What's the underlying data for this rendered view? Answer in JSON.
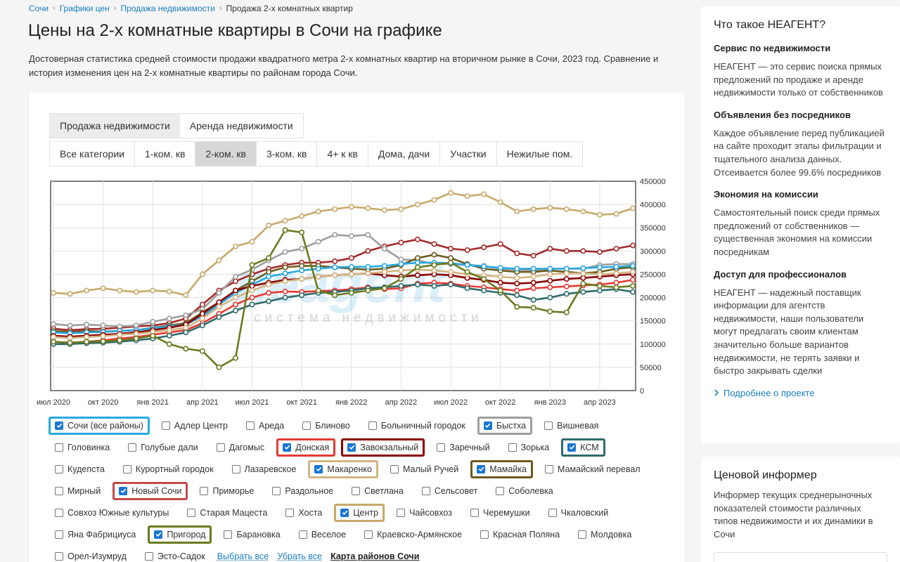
{
  "breadcrumb": {
    "items": [
      "Сочи",
      "Графики цен",
      "Продажа недвижимости"
    ],
    "current": "Продажа 2-х комнатных квартир",
    "sep": "›"
  },
  "page": {
    "title": "Цены на 2-х комнатные квартиры в Сочи на графике",
    "description": "Достоверная статистика средней стоимости продажи квадратного метра 2-х комнатных квартир на вторичном рынке в Сочи, 2023 год. Сравнение и история изменения цен на 2-х комнатные квартиры по районам города Сочи."
  },
  "tabs_main": [
    {
      "label": "Продажа недвижимости",
      "active": true
    },
    {
      "label": "Аренда недвижимости",
      "active": false
    }
  ],
  "tabs_sub": [
    {
      "label": "Все категории",
      "active": false
    },
    {
      "label": "1-ком. кв",
      "active": false
    },
    {
      "label": "2-ком. кв",
      "active": true
    },
    {
      "label": "3-ком. кв",
      "active": false
    },
    {
      "label": "4+ к кв",
      "active": false
    },
    {
      "label": "Дома, дачи",
      "active": false
    },
    {
      "label": "Участки",
      "active": false
    },
    {
      "label": "Нежилые пом.",
      "active": false
    }
  ],
  "watermark": {
    "logo": "neagent",
    "tagline": "система недвижимости"
  },
  "chart_data": {
    "type": "line",
    "title": "",
    "xlabel": "",
    "ylabel": "",
    "ylim": [
      0,
      450000
    ],
    "yticks": [
      "450000",
      "400000",
      "350000",
      "300000",
      "250000",
      "200000",
      "150000",
      "100000",
      "50000",
      "0"
    ],
    "grid": true,
    "x_tick_labels": [
      "июл 2020",
      "окт 2020",
      "янв 2021",
      "апр 2021",
      "июл 2021",
      "окт 2021",
      "янв 2022",
      "апр 2022",
      "июл 2022",
      "окт 2022",
      "янв 2023",
      "апр 2023"
    ],
    "x_tick_index": [
      0,
      3,
      6,
      9,
      12,
      15,
      18,
      21,
      24,
      27,
      30,
      33
    ],
    "n_points": 36,
    "series": [
      {
        "name": "Центр",
        "color": "#c8a96b",
        "values": [
          210000,
          208000,
          215000,
          220000,
          215000,
          212000,
          215000,
          213000,
          205000,
          250000,
          280000,
          310000,
          320000,
          355000,
          365000,
          375000,
          385000,
          390000,
          395000,
          392000,
          388000,
          390000,
          400000,
          410000,
          425000,
          418000,
          422000,
          405000,
          385000,
          390000,
          393000,
          390000,
          385000,
          378000,
          380000,
          392000
        ]
      },
      {
        "name": "Новый Сочи",
        "color": "#a52a2a",
        "values": [
          133000,
          130000,
          132000,
          133000,
          135000,
          138000,
          140000,
          145000,
          155000,
          185000,
          215000,
          235000,
          250000,
          262000,
          270000,
          275000,
          275000,
          278000,
          285000,
          300000,
          310000,
          318000,
          325000,
          315000,
          305000,
          302000,
          308000,
          315000,
          295000,
          290000,
          305000,
          300000,
          300000,
          298000,
          305000,
          312000
        ]
      },
      {
        "name": "Быстха",
        "color": "#9e9e9e",
        "values": [
          143000,
          140000,
          142000,
          140000,
          138000,
          140000,
          148000,
          155000,
          162000,
          175000,
          210000,
          245000,
          260000,
          280000,
          298000,
          305000,
          320000,
          335000,
          332000,
          335000,
          305000,
          282000,
          280000,
          272000,
          272000,
          270000,
          268000,
          262000,
          260000,
          258000,
          262000,
          262000,
          262000,
          270000,
          272000,
          272000
        ]
      },
      {
        "name": "Мамайка",
        "color": "#6b5a1e",
        "values": [
          128000,
          126000,
          128000,
          127000,
          128000,
          130000,
          135000,
          140000,
          145000,
          168000,
          190000,
          215000,
          235000,
          255000,
          265000,
          268000,
          268000,
          265000,
          262000,
          260000,
          262000,
          270000,
          285000,
          292000,
          285000,
          272000,
          262000,
          258000,
          255000,
          255000,
          258000,
          255000,
          252000,
          255000,
          262000,
          265000
        ]
      },
      {
        "name": "Сочи (все районы)",
        "color": "#29a8e0",
        "values": [
          125000,
          123000,
          125000,
          126000,
          128000,
          130000,
          134000,
          138000,
          142000,
          160000,
          185000,
          210000,
          228000,
          245000,
          252000,
          258000,
          262000,
          265000,
          266000,
          266000,
          268000,
          272000,
          275000,
          275000,
          274000,
          270000,
          267000,
          264000,
          262000,
          262000,
          262000,
          262000,
          263000,
          265000,
          266000,
          268000
        ]
      },
      {
        "name": "Донская",
        "color": "#e53935",
        "values": [
          105000,
          103000,
          105000,
          108000,
          112000,
          115000,
          120000,
          125000,
          130000,
          145000,
          165000,
          185000,
          200000,
          210000,
          213000,
          212000,
          214000,
          215000,
          218000,
          222000,
          218000,
          220000,
          230000,
          232000,
          230000,
          225000,
          222000,
          218000,
          215000,
          220000,
          222000,
          224000,
          226000,
          228000,
          232000,
          238000
        ]
      },
      {
        "name": "Завокзальный",
        "color": "#8b0000",
        "values": [
          118000,
          116000,
          118000,
          120000,
          122000,
          125000,
          130000,
          135000,
          142000,
          165000,
          190000,
          215000,
          225000,
          232000,
          238000,
          240000,
          245000,
          248000,
          250000,
          252000,
          248000,
          245000,
          248000,
          250000,
          248000,
          242000,
          238000,
          232000,
          230000,
          232000,
          236000,
          240000,
          242000,
          245000,
          248000,
          250000
        ]
      },
      {
        "name": "Макаренко",
        "color": "#d4b483",
        "values": [
          115000,
          113000,
          115000,
          117000,
          120000,
          122000,
          126000,
          130000,
          135000,
          155000,
          180000,
          200000,
          215000,
          228000,
          235000,
          240000,
          245000,
          248000,
          250000,
          252000,
          255000,
          258000,
          260000,
          258000,
          255000,
          250000,
          248000,
          245000,
          242000,
          245000,
          250000,
          252000,
          252000,
          250000,
          252000,
          255000
        ]
      },
      {
        "name": "КСМ",
        "color": "#2e6b6b",
        "values": [
          100000,
          100000,
          102000,
          103000,
          105000,
          108000,
          112000,
          118000,
          125000,
          140000,
          158000,
          172000,
          185000,
          192000,
          200000,
          205000,
          210000,
          212000,
          215000,
          220000,
          222000,
          225000,
          228000,
          225000,
          228000,
          220000,
          215000,
          210000,
          205000,
          195000,
          200000,
          208000,
          212000,
          215000,
          218000,
          212000
        ]
      },
      {
        "name": "Пригород",
        "color": "#6b7a1e",
        "values": [
          105000,
          103000,
          105000,
          106000,
          108000,
          112000,
          118000,
          100000,
          90000,
          85000,
          50000,
          70000,
          270000,
          285000,
          345000,
          340000,
          215000,
          205000,
          210000,
          215000,
          220000,
          240000,
          265000,
          270000,
          275000,
          255000,
          240000,
          215000,
          180000,
          178000,
          170000,
          168000,
          230000,
          225000,
          222000,
          225000
        ]
      }
    ]
  },
  "checkboxes": {
    "rows": [
      [
        {
          "label": "Сочи (все районы)",
          "checked": true,
          "color": "#29a8e0"
        },
        {
          "label": "Адлер Центр",
          "checked": false
        },
        {
          "label": "Ареда",
          "checked": false
        },
        {
          "label": "Блиново",
          "checked": false
        },
        {
          "label": "Больничный городок",
          "checked": false
        },
        {
          "label": "Быстха",
          "checked": true,
          "color": "#9e9e9e"
        },
        {
          "label": "Вишневая",
          "checked": false
        }
      ],
      [
        {
          "label": "Головинка",
          "checked": false
        },
        {
          "label": "Голубые дали",
          "checked": false
        },
        {
          "label": "Дагомыс",
          "checked": false
        },
        {
          "label": "Донская",
          "checked": true,
          "color": "#e53935"
        },
        {
          "label": "Завокзальный",
          "checked": true,
          "color": "#8b0000"
        },
        {
          "label": "Заречный",
          "checked": false
        },
        {
          "label": "Зорька",
          "checked": false
        },
        {
          "label": "КСМ",
          "checked": true,
          "color": "#2e6b6b"
        }
      ],
      [
        {
          "label": "Кудепста",
          "checked": false
        },
        {
          "label": "Курортный городок",
          "checked": false
        },
        {
          "label": "Лазаревское",
          "checked": false
        },
        {
          "label": "Макаренко",
          "checked": true,
          "color": "#d4b483"
        },
        {
          "label": "Малый Ручей",
          "checked": false
        },
        {
          "label": "Мамайка",
          "checked": true,
          "color": "#6b5a1e"
        },
        {
          "label": "Мамайский перевал",
          "checked": false
        }
      ],
      [
        {
          "label": "Мирный",
          "checked": false
        },
        {
          "label": "Новый Сочи",
          "checked": true,
          "color": "#c44a4a"
        },
        {
          "label": "Приморье",
          "checked": false
        },
        {
          "label": "Раздольное",
          "checked": false
        },
        {
          "label": "Светлана",
          "checked": false
        },
        {
          "label": "Сельсовет",
          "checked": false
        },
        {
          "label": "Соболевка",
          "checked": false
        }
      ],
      [
        {
          "label": "Совхоз Южные культуры",
          "checked": false
        },
        {
          "label": "Старая Мацеста",
          "checked": false
        },
        {
          "label": "Хоста",
          "checked": false
        },
        {
          "label": "Центр",
          "checked": true,
          "color": "#c8a96b"
        },
        {
          "label": "Чайсовхоз",
          "checked": false
        },
        {
          "label": "Черемушки",
          "checked": false
        },
        {
          "label": "Чкаловский",
          "checked": false
        }
      ],
      [
        {
          "label": "Яна Фабрициуса",
          "checked": false
        },
        {
          "label": "Пригород",
          "checked": true,
          "color": "#6b7a1e"
        },
        {
          "label": "Барановка",
          "checked": false
        },
        {
          "label": "Веселое",
          "checked": false
        },
        {
          "label": "Краевско-Армянское",
          "checked": false
        },
        {
          "label": "Красная Поляна",
          "checked": false
        },
        {
          "label": "Молдовка",
          "checked": false
        }
      ],
      [
        {
          "label": "Орел-Изумруд",
          "checked": false
        },
        {
          "label": "Эсто-Садок",
          "checked": false
        }
      ]
    ],
    "select_all": "Выбрать все",
    "deselect_all": "Убрать все",
    "map_link": "Карта районов Сочи"
  },
  "sidebar": {
    "title": "Что такое НЕАГЕНТ?",
    "sections": [
      {
        "heading": "Сервис по недвижимости",
        "text": "НЕАГЕНТ — это сервис поиска прямых предложений по продаже и аренде недвижимости только от собственников"
      },
      {
        "heading": "Объявления без посредников",
        "text": "Каждое объявление перед публикацией на сайте проходит этапы фильтрации и тщательного анализа данных. Отсеивается более 99.6% посредников"
      },
      {
        "heading": "Экономия на комиссии",
        "text": "Самостоятельный поиск среди прямых предложений от собственников — существенная экономия на комиссии посредникам"
      },
      {
        "heading": "Доступ для профессионалов",
        "text": "НЕАГЕНТ — надежный поставщик информации для агентств недвижимости, наши пользователи могут предлагать своим клиентам значительно больше вариантов недвижимости, не терять заявки и быстро закрывать сделки"
      }
    ],
    "more_link": "Подробнее о проекте"
  },
  "informer": {
    "title": "Ценовой информер",
    "text": "Информер текущих среднерыночных показателей стоимости различных типов недвижимости и их динамики в Сочи"
  }
}
